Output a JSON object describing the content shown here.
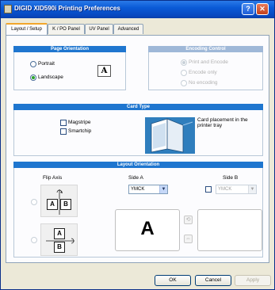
{
  "window": {
    "title": "DIGID XID590i Printing Preferences",
    "help_label": "?",
    "close_label": "✕"
  },
  "tabs": [
    {
      "label": "Layout / Setup",
      "active": true
    },
    {
      "label": "K / PO Panel"
    },
    {
      "label": "UV Panel"
    },
    {
      "label": "Advanced"
    }
  ],
  "page_orientation": {
    "header": "Page Orientation",
    "options": [
      {
        "label": "Portrait",
        "checked": false
      },
      {
        "label": "Landscape",
        "checked": true
      }
    ],
    "preview_glyph": "A"
  },
  "encoding_control": {
    "header": "Encoding Control",
    "options": [
      {
        "label": "Print and Encode",
        "checked": true
      },
      {
        "label": "Encode only",
        "checked": false
      },
      {
        "label": "No encoding",
        "checked": false
      }
    ]
  },
  "card_type": {
    "header": "Card Type",
    "checkboxes": [
      {
        "label": "Magstripe",
        "checked": false
      },
      {
        "label": "Smartchip",
        "checked": false
      }
    ],
    "placement_text": "Card placement in the printer tray"
  },
  "layout_orientation": {
    "header": "Layout Orientation",
    "flip_axis_label": "Flip Axis",
    "side_a_label": "Side A",
    "side_b_label": "Side B",
    "side_a_value": "YMCK",
    "side_b_value": "YMCK",
    "side_b_enabled": false,
    "flip_vertical": {
      "left": "A",
      "right": "B"
    },
    "flip_horizontal": {
      "top": "A",
      "bottom": "B"
    },
    "preview_a_letter": "A"
  },
  "buttons": {
    "ok": "OK",
    "cancel": "Cancel",
    "apply": "Apply"
  },
  "colors": {
    "header_blue": "#1f76cf",
    "radio_green": "#2aa32a"
  }
}
